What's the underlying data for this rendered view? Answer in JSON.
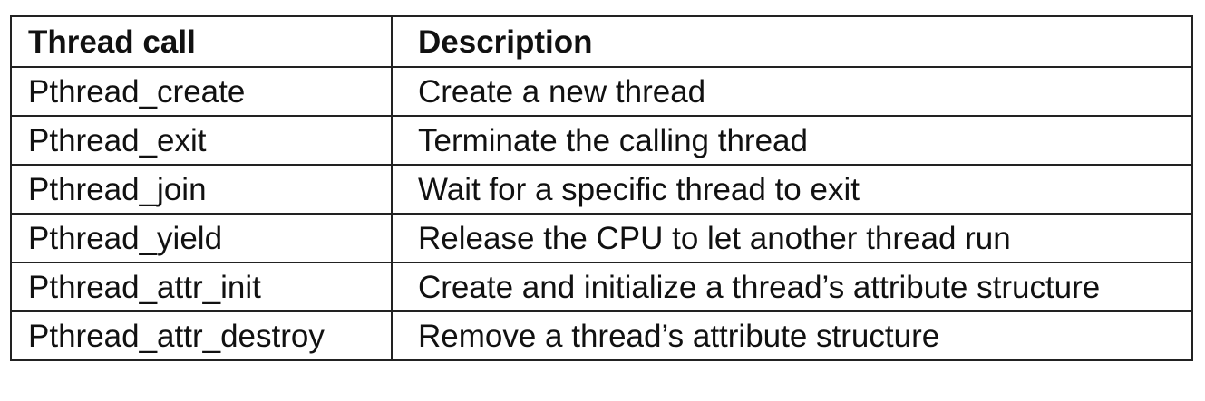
{
  "table": {
    "headers": {
      "call": "Thread call",
      "description": "Description"
    },
    "rows": [
      {
        "call": "Pthread_create",
        "description": "Create a new thread"
      },
      {
        "call": "Pthread_exit",
        "description": "Terminate the calling thread"
      },
      {
        "call": "Pthread_join",
        "description": "Wait for a specific thread to exit"
      },
      {
        "call": "Pthread_yield",
        "description": "Release the CPU to let another thread run"
      },
      {
        "call": "Pthread_attr_init",
        "description": "Create and initialize a thread’s attribute structure"
      },
      {
        "call": "Pthread_attr_destroy",
        "description": "Remove a thread’s attribute structure"
      }
    ]
  }
}
